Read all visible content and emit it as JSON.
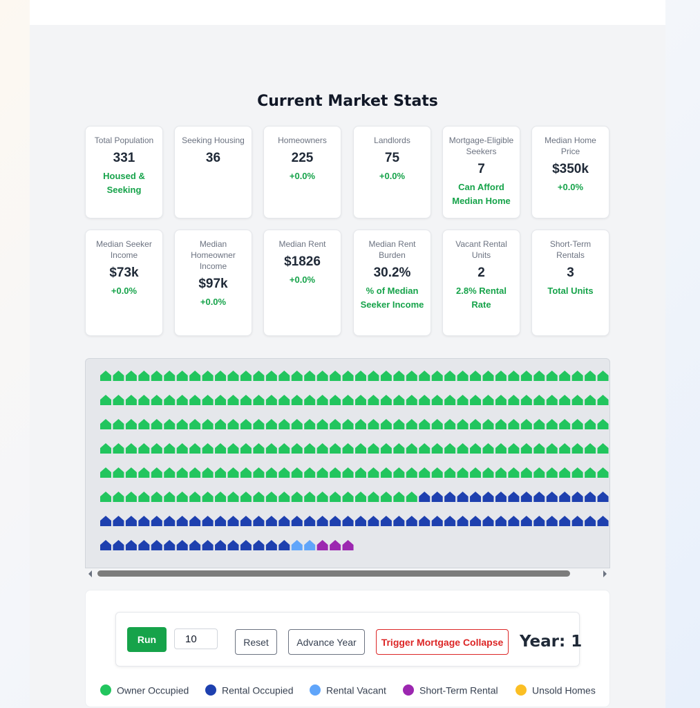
{
  "section_title": "Current Market Stats",
  "stats": [
    {
      "label": "Total Population",
      "value": "331",
      "sub": "Housed & Seeking"
    },
    {
      "label": "Seeking Housing",
      "value": "36",
      "sub": ""
    },
    {
      "label": "Homeowners",
      "value": "225",
      "sub": "+0.0%"
    },
    {
      "label": "Landlords",
      "value": "75",
      "sub": "+0.0%"
    },
    {
      "label": "Mortgage-Eligible Seekers",
      "value": "7",
      "sub": "Can Afford Median Home"
    },
    {
      "label": "Median Home Price",
      "value": "$350k",
      "sub": "+0.0%"
    },
    {
      "label": "Median Seeker Income",
      "value": "$73k",
      "sub": "+0.0%"
    },
    {
      "label": "Median Homeowner Income",
      "value": "$97k",
      "sub": "+0.0%"
    },
    {
      "label": "Median Rent",
      "value": "$1826",
      "sub": "+0.0%"
    },
    {
      "label": "Median Rent Burden",
      "value": "30.2%",
      "sub": "% of Median Seeker Income"
    },
    {
      "label": "Vacant Rental Units",
      "value": "2",
      "sub": "2.8% Rental Rate"
    },
    {
      "label": "Short-Term Rentals",
      "value": "3",
      "sub": "Total Units"
    }
  ],
  "housing_grid": {
    "counts": {
      "owner_occupied": 225,
      "rental_occupied": 70,
      "rental_vacant": 2,
      "short_term_rental": 3,
      "unsold": 0
    }
  },
  "colors": {
    "owner_occupied": "#22c55e",
    "rental_occupied": "#1e40af",
    "rental_vacant": "#60a5fa",
    "short_term_rental": "#9c27b0",
    "unsold": "#fbbf24",
    "accent_green": "#16a34a",
    "danger_red": "#dc2626"
  },
  "controls": {
    "run_label": "Run",
    "years_value": "10",
    "reset_label": "Reset",
    "advance_label": "Advance Year",
    "collapse_label": "Trigger Mortgage Collapse",
    "year_text": "Year: 1"
  },
  "legend": [
    {
      "label": "Owner Occupied",
      "color": "#22c55e"
    },
    {
      "label": "Rental Occupied",
      "color": "#1e40af"
    },
    {
      "label": "Rental Vacant",
      "color": "#60a5fa"
    },
    {
      "label": "Short-Term Rental",
      "color": "#9c27b0"
    },
    {
      "label": "Unsold Homes",
      "color": "#fbbf24"
    }
  ]
}
